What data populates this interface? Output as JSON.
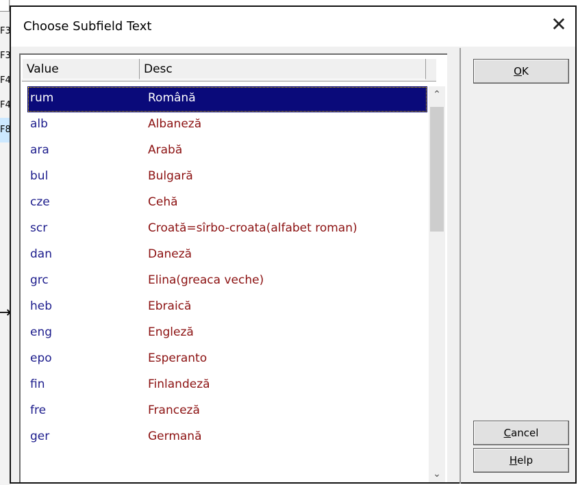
{
  "background": {
    "rows": [
      {
        "label": "F3",
        "selected": false
      },
      {
        "label": "F3",
        "selected": false
      },
      {
        "label": "F4",
        "selected": false
      },
      {
        "label": "F4",
        "selected": false
      },
      {
        "label": "F8",
        "selected": true
      }
    ]
  },
  "dialog": {
    "title": "Choose Subfield Text",
    "close_label": "✕",
    "columns": {
      "value": "Value",
      "desc": "Desc"
    },
    "rows": [
      {
        "value": "rum",
        "desc": "Română",
        "selected": true
      },
      {
        "value": "alb",
        "desc": "Albaneză",
        "selected": false
      },
      {
        "value": "ara",
        "desc": "Arabă",
        "selected": false
      },
      {
        "value": "bul",
        "desc": "Bulgară",
        "selected": false
      },
      {
        "value": "cze",
        "desc": "Cehă",
        "selected": false
      },
      {
        "value": "scr",
        "desc": "Croată=sîrbo-croata(alfabet roman)",
        "selected": false
      },
      {
        "value": "dan",
        "desc": "Daneză",
        "selected": false
      },
      {
        "value": "grc",
        "desc": "Elina(greaca veche)",
        "selected": false
      },
      {
        "value": "heb",
        "desc": "Ebraică",
        "selected": false
      },
      {
        "value": "eng",
        "desc": "Engleză",
        "selected": false
      },
      {
        "value": "epo",
        "desc": "Esperanto",
        "selected": false
      },
      {
        "value": "fin",
        "desc": "Finlandeză",
        "selected": false
      },
      {
        "value": "fre",
        "desc": "Franceză",
        "selected": false
      },
      {
        "value": "ger",
        "desc": "Germană",
        "selected": false
      }
    ],
    "buttons": {
      "ok": {
        "mnemonic": "O",
        "rest": "K"
      },
      "cancel": {
        "mnemonic": "C",
        "rest": "ancel"
      },
      "help": {
        "mnemonic": "H",
        "rest": "elp"
      }
    },
    "scrollbar": {
      "up_icon": "chevron-up-icon",
      "down_icon": "chevron-down-icon"
    }
  },
  "colors": {
    "selection_bg": "#0a0a7a",
    "value_text": "#1c1c8c",
    "desc_text": "#8b1010"
  }
}
